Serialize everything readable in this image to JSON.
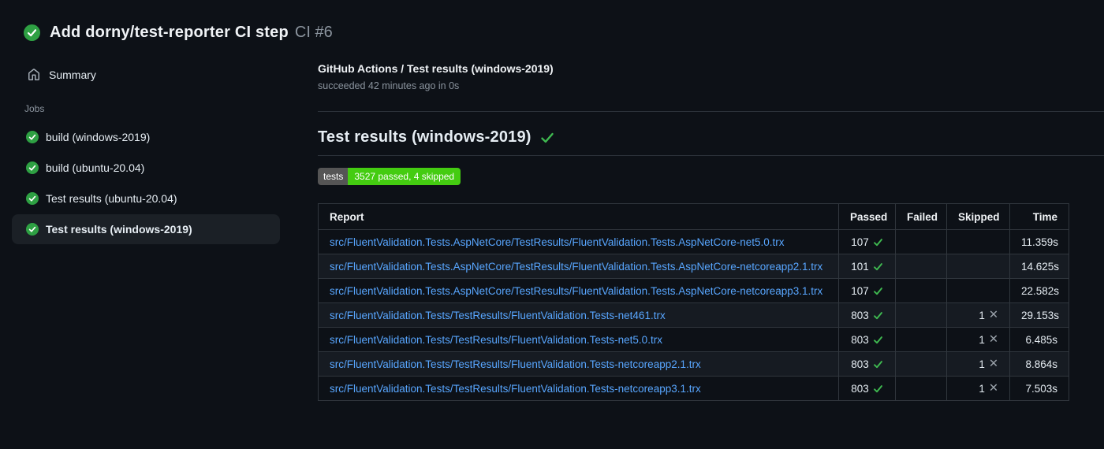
{
  "header": {
    "title": "Add dorny/test-reporter CI step",
    "run_number": "CI #6"
  },
  "sidebar": {
    "summary_label": "Summary",
    "jobs_label": "Jobs",
    "jobs": [
      {
        "label": "build (windows-2019)",
        "selected": false
      },
      {
        "label": "build (ubuntu-20.04)",
        "selected": false
      },
      {
        "label": "Test results (ubuntu-20.04)",
        "selected": false
      },
      {
        "label": "Test results (windows-2019)",
        "selected": true
      }
    ]
  },
  "main": {
    "check_title": "GitHub Actions / Test results (windows-2019)",
    "check_status": "succeeded 42 minutes ago in 0s",
    "section_title": "Test results (windows-2019)",
    "badge": {
      "label": "tests",
      "value": "3527 passed, 4 skipped"
    },
    "table": {
      "headers": [
        "Report",
        "Passed",
        "Failed",
        "Skipped",
        "Time"
      ],
      "rows": [
        {
          "report": "src/FluentValidation.Tests.AspNetCore/TestResults/FluentValidation.Tests.AspNetCore-net5.0.trx",
          "passed": "107",
          "failed": "",
          "skipped": "",
          "time": "11.359s"
        },
        {
          "report": "src/FluentValidation.Tests.AspNetCore/TestResults/FluentValidation.Tests.AspNetCore-netcoreapp2.1.trx",
          "passed": "101",
          "failed": "",
          "skipped": "",
          "time": "14.625s"
        },
        {
          "report": "src/FluentValidation.Tests.AspNetCore/TestResults/FluentValidation.Tests.AspNetCore-netcoreapp3.1.trx",
          "passed": "107",
          "failed": "",
          "skipped": "",
          "time": "22.582s"
        },
        {
          "report": "src/FluentValidation.Tests/TestResults/FluentValidation.Tests-net461.trx",
          "passed": "803",
          "failed": "",
          "skipped": "1",
          "time": "29.153s"
        },
        {
          "report": "src/FluentValidation.Tests/TestResults/FluentValidation.Tests-net5.0.trx",
          "passed": "803",
          "failed": "",
          "skipped": "1",
          "time": "6.485s"
        },
        {
          "report": "src/FluentValidation.Tests/TestResults/FluentValidation.Tests-netcoreapp2.1.trx",
          "passed": "803",
          "failed": "",
          "skipped": "1",
          "time": "8.864s"
        },
        {
          "report": "src/FluentValidation.Tests/TestResults/FluentValidation.Tests-netcoreapp3.1.trx",
          "passed": "803",
          "failed": "",
          "skipped": "1",
          "time": "7.503s"
        }
      ]
    }
  },
  "colors": {
    "background": "#0d1117",
    "success_green": "#2ea043",
    "check_green": "#3fb950",
    "link_blue": "#58a6ff",
    "muted_text": "#8b949e",
    "table_border": "#30363d",
    "row_alt_bg": "#161b22",
    "badge_label_bg": "#555555",
    "badge_value_bg": "#44cc11"
  }
}
